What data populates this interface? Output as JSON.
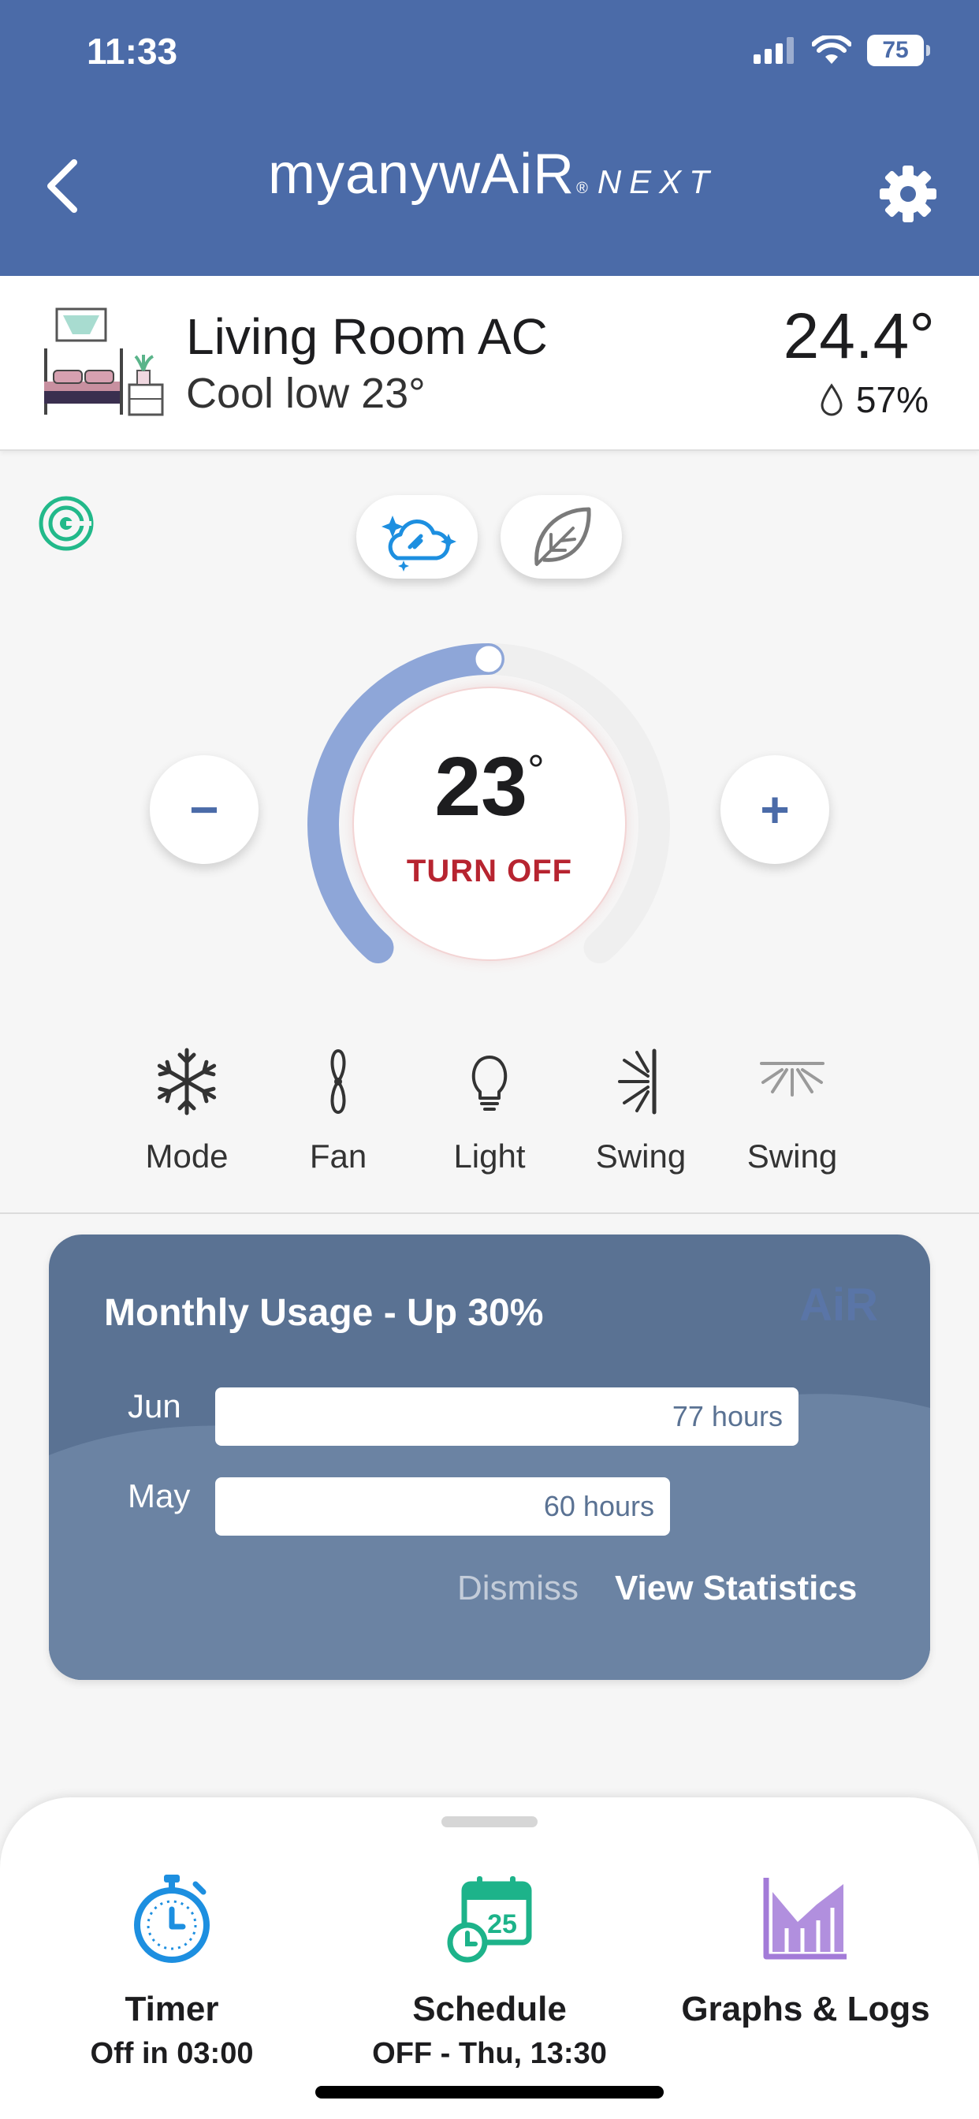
{
  "status_bar": {
    "time": "11:33",
    "battery": "75"
  },
  "header": {
    "brand_main": "myanywAiR",
    "brand_reg": "®",
    "brand_suffix": "NEXT"
  },
  "device": {
    "name": "Living Room AC",
    "mode_summary": "Cool low 23°",
    "room_temperature": "24.4°",
    "humidity": "57%"
  },
  "control": {
    "set_temperature": "23",
    "degree_symbol": "°",
    "power_action": "TURN OFF",
    "minus_label": "−",
    "plus_label": "+",
    "dial_level_fraction": 0.5
  },
  "modes": [
    {
      "label": "Mode",
      "icon": "snowflake-icon"
    },
    {
      "label": "Fan",
      "icon": "fan-icon"
    },
    {
      "label": "Light",
      "icon": "lightbulb-icon"
    },
    {
      "label": "Swing",
      "icon": "swing-vertical-icon"
    },
    {
      "label": "Swing",
      "icon": "swing-horizontal-icon"
    }
  ],
  "usage": {
    "title": "Monthly Usage - Up 30%",
    "logo": "AiR",
    "rows": [
      {
        "month": "Jun",
        "value": "77 hours",
        "hours": 77
      },
      {
        "month": "May",
        "value": "60 hours",
        "hours": 60
      }
    ],
    "dismiss_label": "Dismiss",
    "view_label": "View Statistics"
  },
  "bottom_sheet": {
    "timer": {
      "title": "Timer",
      "subtitle": "Off in 03:00",
      "icon": "stopwatch-icon"
    },
    "schedule": {
      "title": "Schedule",
      "subtitle": "OFF - Thu, 13:30",
      "icon": "calendar-icon",
      "day": "25"
    },
    "graphs": {
      "title": "Graphs & Logs",
      "icon": "graph-icon"
    }
  },
  "colors": {
    "header_bg": "#4b6ba8",
    "accent_red": "#b72430",
    "dial_arc": "#8ea6d8",
    "radar_green": "#22b98a",
    "timer_blue": "#1d8fe0",
    "schedule_green": "#1db38a",
    "graph_purple": "#a37bd8"
  }
}
